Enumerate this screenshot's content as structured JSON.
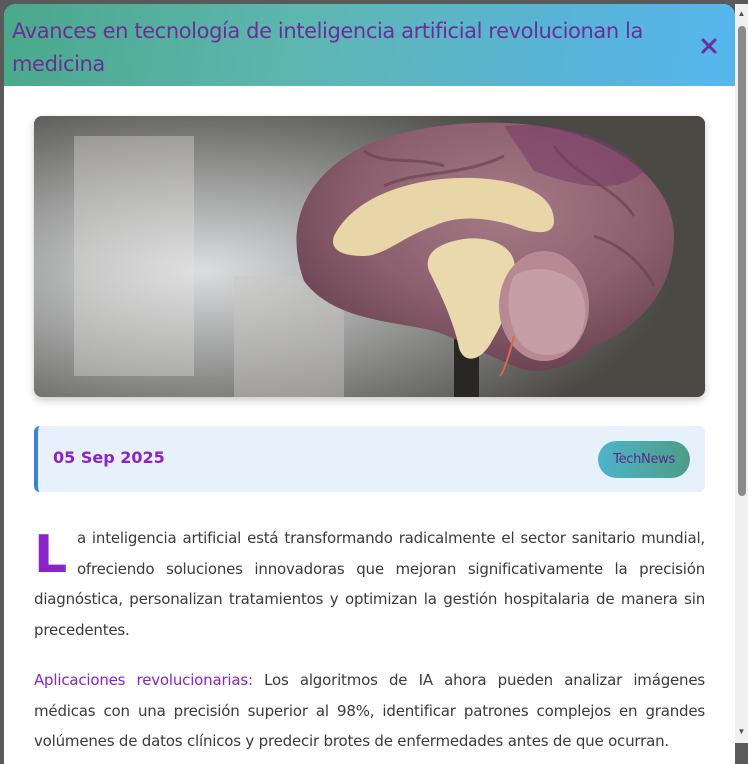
{
  "modal": {
    "title": "Avances en tecnología de inteligencia artificial revolucionan la medicina",
    "close_label": "×"
  },
  "hero_image": {
    "subject": "brain model cross-section"
  },
  "meta": {
    "date": "05 Sep 2025",
    "source": "TechNews"
  },
  "article": {
    "dropcap": "L",
    "intro": "a inteligencia artificial está transformando radicalmente el sector sanitario mundial, ofreciendo soluciones innovadoras que mejoran significativamente la precisión diagnóstica, personalizan tratamientos y optimizan la gestión hospitalaria de manera sin precedentes.",
    "section_label": "Aplicaciones revolucionarias:",
    "section_text": " Los algoritmos de IA ahora pueden analizar imágenes médicas con una precisión superior al 98%, identificar patrones complejos en grandes volúmenes de datos clínicos y predecir brotes de enfermedades antes de que ocurran."
  },
  "colors": {
    "accent": "#8a23c8",
    "title": "#6b2d9a",
    "meta_border": "#3a7fd8",
    "meta_bg": "#e6f1fb"
  },
  "icons": {
    "close": "close-icon",
    "scroll_up": "chevron-up-icon",
    "scroll_down": "chevron-down-icon"
  }
}
